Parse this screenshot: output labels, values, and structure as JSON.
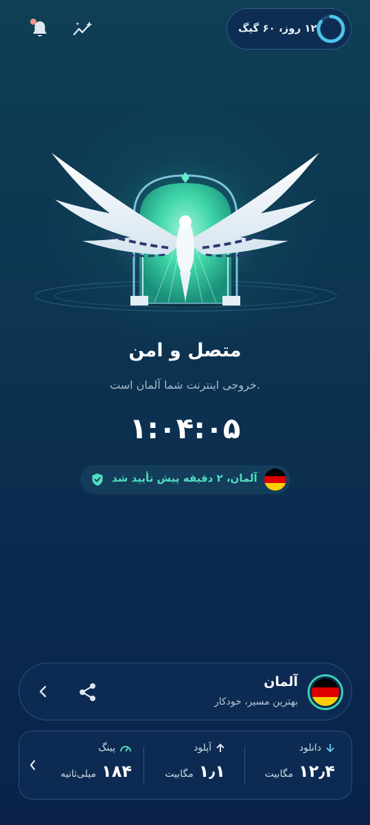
{
  "header": {
    "plan_text": "۱۲ روز، ۶۰ گیگ",
    "plan_ring_fraction": 0.85
  },
  "status": {
    "title": "متصل و امن",
    "subtitle": "خروجی اینترنت شما آلمان است.",
    "timer": "۱:۰۴:۰۵",
    "verified": "آلمان، ۲ دقیقه پیش تأیید شد"
  },
  "location": {
    "name": "آلمان",
    "subtitle": "بهترین مسیر، خودکار"
  },
  "stats": {
    "download": {
      "label": "دانلود",
      "value": "۱۲٫۴",
      "unit": "مگابیت"
    },
    "upload": {
      "label": "آپلود",
      "value": "۱٫۱",
      "unit": "مگابیت"
    },
    "ping": {
      "label": "پینگ",
      "value": "۱۸۴",
      "unit": "میلی‌ثانیه"
    }
  },
  "colors": {
    "accent": "#3ad3b0",
    "verify_text": "#4fe0c0",
    "notification_dot": "#f2928a",
    "flag_black": "#000000",
    "flag_red": "#dd0000",
    "flag_gold": "#ffce00"
  },
  "icons": [
    "bell-icon",
    "stats-sparkle-icon",
    "shield-check-icon",
    "share-icon",
    "chevron-left-icon",
    "arrow-down-icon",
    "arrow-up-icon",
    "speedometer-icon",
    "germany-flag-icon"
  ]
}
